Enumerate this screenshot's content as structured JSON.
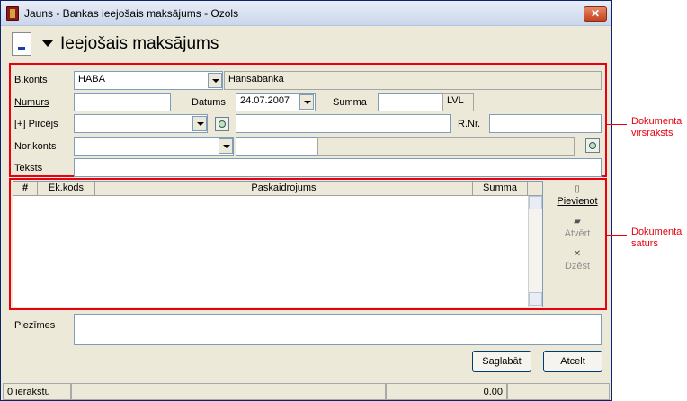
{
  "window": {
    "title": "Jauns - Bankas ieejošais maksājums - Ozols",
    "close_label": "✕"
  },
  "header": {
    "title": "Ieejošais maksājums"
  },
  "form": {
    "bkonts": {
      "label": "B.konts",
      "value": "HABA",
      "bank_name": "Hansabanka"
    },
    "numurs": {
      "label": "Numurs",
      "value": ""
    },
    "datums": {
      "label": "Datums",
      "value": "24.07.2007"
    },
    "summa": {
      "label": "Summa",
      "value": "",
      "currency": "LVL"
    },
    "pircejs": {
      "label": "[+] Pircējs",
      "value": "",
      "name": ""
    },
    "rnr": {
      "label": "R.Nr.",
      "value": ""
    },
    "norkonts": {
      "label": "Nor.konts",
      "value": ""
    },
    "teksts": {
      "label": "Teksts",
      "value": ""
    }
  },
  "grid": {
    "columns": [
      "#",
      "Ek.kods",
      "Paskaidrojums",
      "Summa"
    ],
    "rows": []
  },
  "side_buttons": {
    "add": "Pievienot",
    "open": "Atvērt",
    "delete": "Dzēst"
  },
  "notes": {
    "label": "Piezīmes",
    "value": ""
  },
  "buttons": {
    "save": "Saglabāt",
    "cancel": "Atcelt"
  },
  "status": {
    "records": "0 ierakstu",
    "total": "0.00"
  },
  "annotations": {
    "header": [
      "Dokumenta",
      "virsraksts"
    ],
    "content": [
      "Dokumenta",
      "saturs"
    ]
  },
  "colors": {
    "highlight": "#e8000e",
    "window_bg": "#ece9d8",
    "titlebar": "#c9d6ea"
  }
}
